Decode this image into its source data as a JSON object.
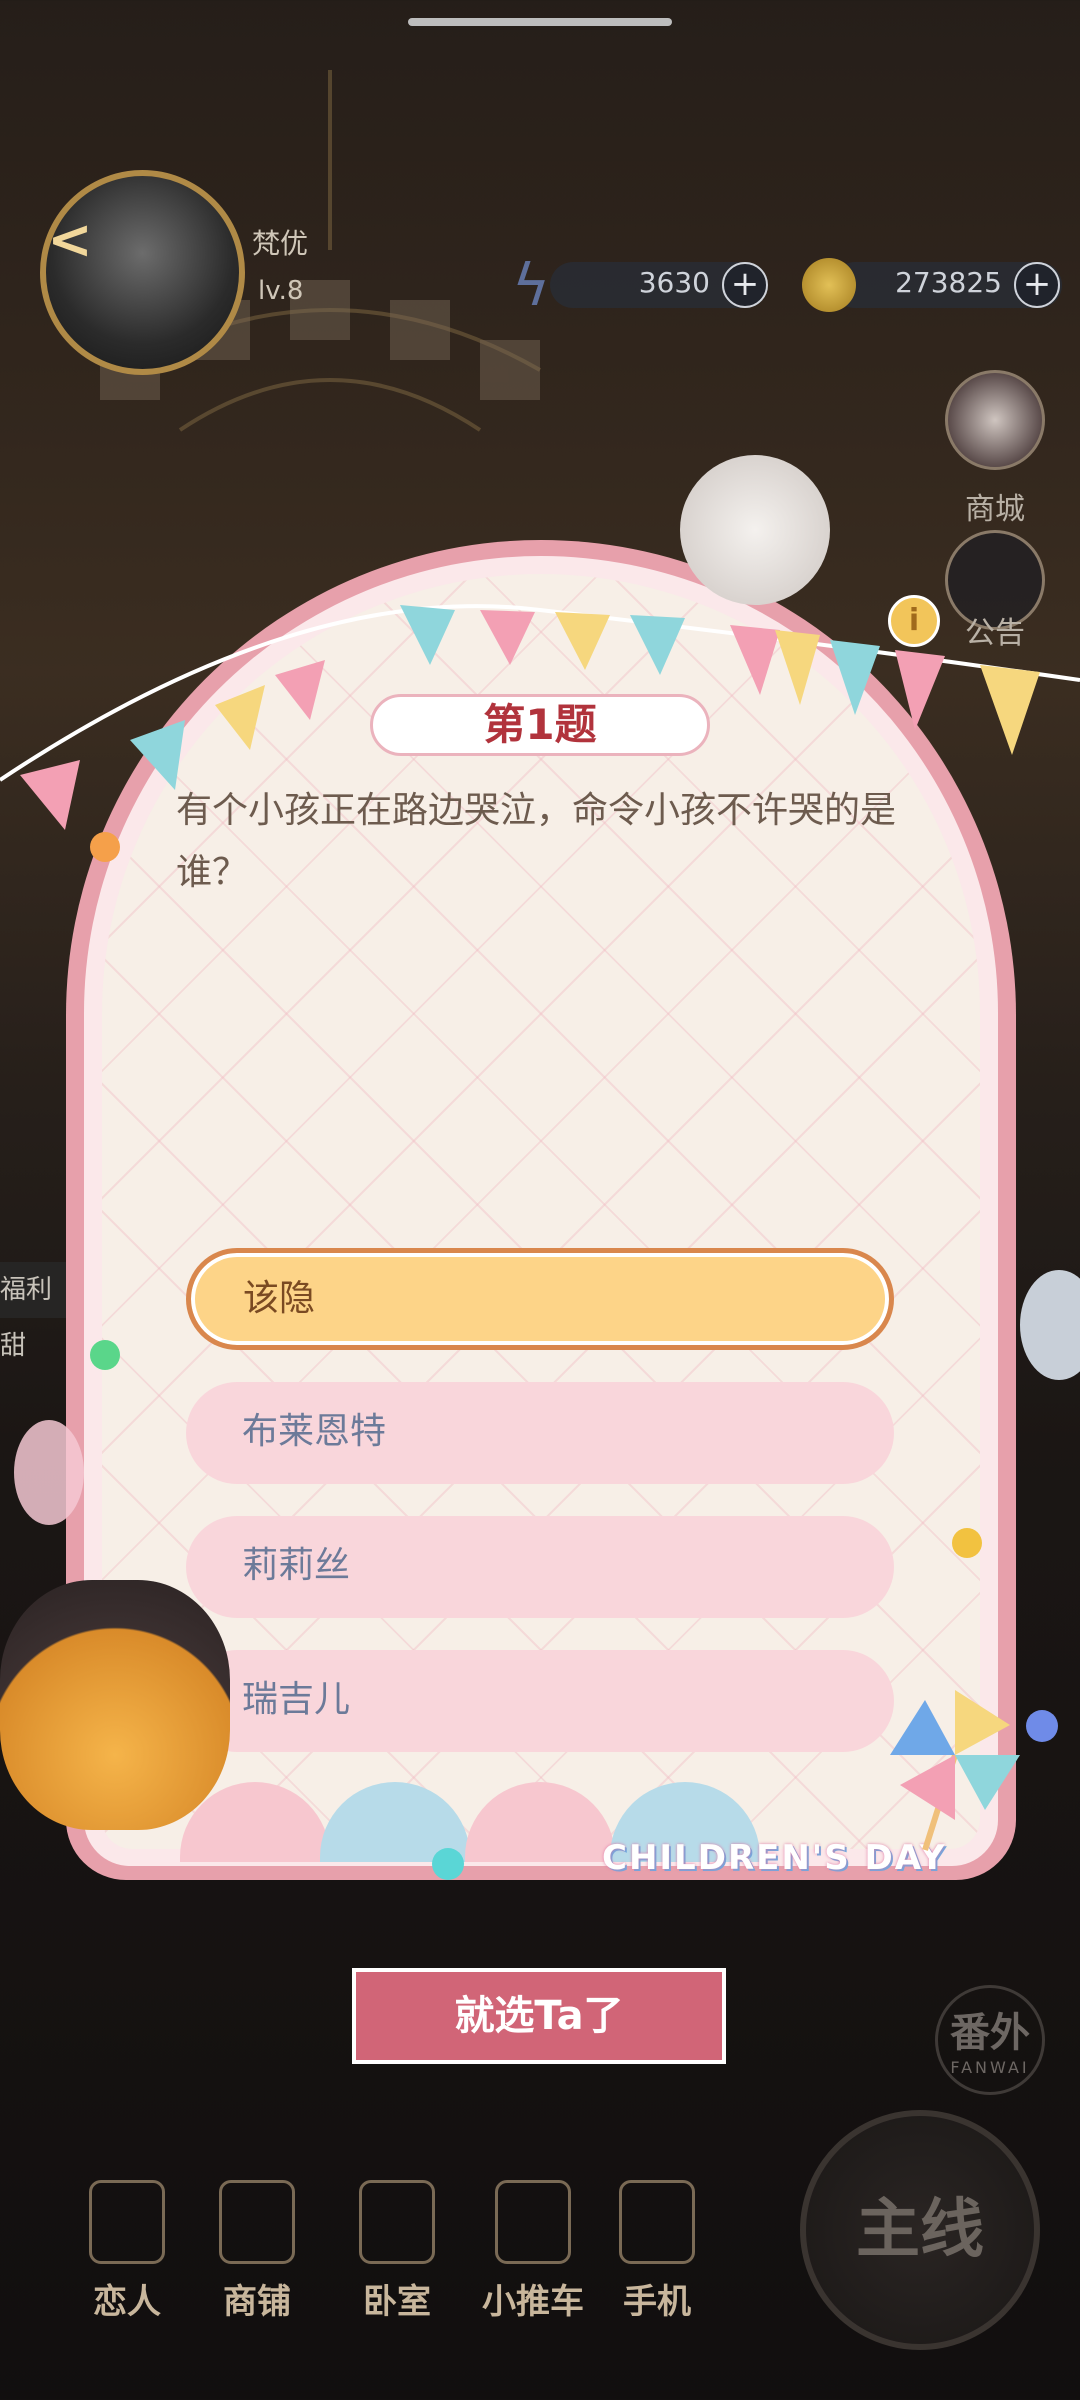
{
  "top_bar": {
    "player_name": "梵优",
    "player_level": "lv.8",
    "energy_value": "3630",
    "coin_value": "273825",
    "plus_symbol": "+"
  },
  "side_menu": {
    "shop_label": "商城",
    "notice_label": "公告"
  },
  "left_tag": "福利甜",
  "quiz": {
    "title": "第1题",
    "question": "有个小孩正在路边哭泣，命令小孩不许哭的是谁？",
    "options": [
      {
        "label": "该隐",
        "selected": true
      },
      {
        "label": "布莱恩特",
        "selected": false
      },
      {
        "label": "莉莉丝",
        "selected": false
      },
      {
        "label": "瑞吉儿",
        "selected": false
      }
    ],
    "banner_text": "CHILDREN'S DAY",
    "confirm_label": "就选Ta了"
  },
  "bottom_nav": {
    "items": [
      {
        "label": "恋人",
        "icon": "lover-icon"
      },
      {
        "label": "商铺",
        "icon": "shopping-bag-icon"
      },
      {
        "label": "卧室",
        "icon": "bedroom-icon"
      },
      {
        "label": "小推车",
        "icon": "cart-icon"
      },
      {
        "label": "手机",
        "icon": "phone-icon"
      }
    ],
    "main_line_label": "主线",
    "extra_label": "番外",
    "extra_sub": "FANWAI"
  },
  "colors": {
    "card_pink": "#fbe8ea",
    "option_selected": "#fdd488",
    "option_default": "#f9d6db",
    "title_red": "#b1333c",
    "confirm_button": "#d16577"
  }
}
